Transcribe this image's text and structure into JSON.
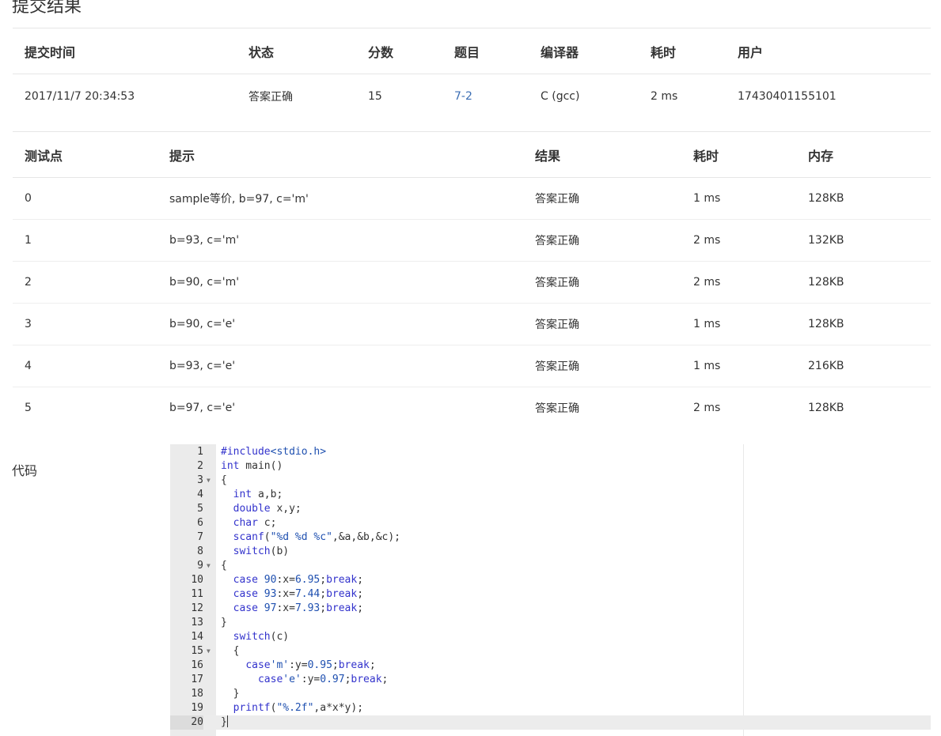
{
  "page": {
    "title": "提交结果",
    "code_label": "代码"
  },
  "summary": {
    "headers": [
      "提交时间",
      "状态",
      "分数",
      "题目",
      "编译器",
      "耗时",
      "用户"
    ],
    "row": {
      "time": "2017/11/7 20:34:53",
      "status": "答案正确",
      "score": "15",
      "problem": "7-2",
      "compiler": "C (gcc)",
      "duration": "2 ms",
      "user": "17430401155101"
    }
  },
  "cases": {
    "headers": [
      "测试点",
      "提示",
      "结果",
      "耗时",
      "内存"
    ],
    "rows": [
      {
        "id": "0",
        "hint": "sample等价, b=97, c='m'",
        "result": "答案正确",
        "time": "1 ms",
        "memory": "128KB"
      },
      {
        "id": "1",
        "hint": "b=93, c='m'",
        "result": "答案正确",
        "time": "2 ms",
        "memory": "132KB"
      },
      {
        "id": "2",
        "hint": "b=90, c='m'",
        "result": "答案正确",
        "time": "2 ms",
        "memory": "128KB"
      },
      {
        "id": "3",
        "hint": "b=90, c='e'",
        "result": "答案正确",
        "time": "1 ms",
        "memory": "128KB"
      },
      {
        "id": "4",
        "hint": "b=93, c='e'",
        "result": "答案正确",
        "time": "1 ms",
        "memory": "216KB"
      },
      {
        "id": "5",
        "hint": "b=97, c='e'",
        "result": "答案正确",
        "time": "2 ms",
        "memory": "128KB"
      }
    ]
  },
  "code": {
    "lines": [
      "#include<stdio.h>",
      "int main()",
      "{",
      "  int a,b;",
      "  double x,y;",
      "  char c;",
      "  scanf(\"%d %d %c\",&a,&b,&c);",
      "  switch(b)",
      "{",
      "  case 90:x=6.95;break;",
      "  case 93:x=7.44;break;",
      "  case 97:x=7.93;break;",
      "}",
      "  switch(c)",
      "  {",
      "    case'm':y=0.95;break;",
      "      case'e':y=0.97;break;",
      "  }",
      "  printf(\"%.2f\",a*x*y);",
      "}"
    ],
    "fold_lines": [
      3,
      9,
      15
    ],
    "active_line": 20
  },
  "colors": {
    "status_ok": "#d9534f",
    "link": "#3b6db3",
    "keyword": "#3333cc",
    "gutter_bg": "#ebebeb"
  }
}
